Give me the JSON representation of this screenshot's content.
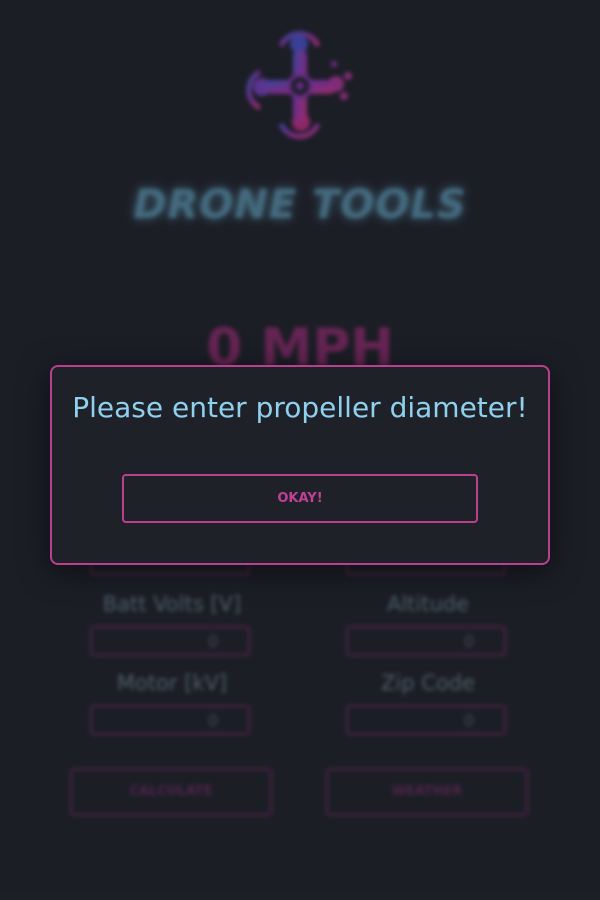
{
  "colors": {
    "background": "#23262e",
    "accent_magenta": "#b8408e",
    "dialog_text": "#8fd0ee",
    "title_glow": "#5b8fa8"
  },
  "header": {
    "logo_icon": "drone-quadcopter-icon",
    "title": "DRONE TOOLS"
  },
  "readout": {
    "speed": "0 MPH"
  },
  "fields": [
    {
      "label": "Batt Volts [V]",
      "value": "0"
    },
    {
      "label": "Altitude",
      "value": "0"
    },
    {
      "label": "Motor [kV]",
      "value": "0"
    },
    {
      "label": "Zip Code",
      "value": "0"
    }
  ],
  "actions": {
    "calculate_label": "CALCULATE",
    "weather_label": "WEATHER"
  },
  "dialog": {
    "message": "Please enter propeller diameter!",
    "button_label": "OKAY!"
  }
}
